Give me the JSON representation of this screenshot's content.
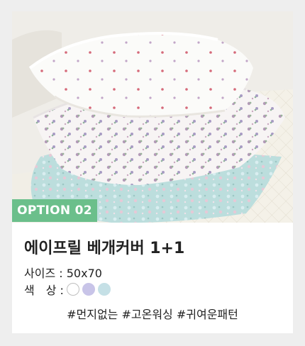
{
  "badge": {
    "label": "OPTION 02"
  },
  "product": {
    "title": "에이프릴 베개커버 1+1",
    "size_label": "사이즈 :",
    "size_value": "50x70",
    "color_label": "색　상 :",
    "colors": [
      {
        "name": "white",
        "hex": "#ffffff",
        "border": "#bfbfbf"
      },
      {
        "name": "lavender",
        "hex": "#c8c4e8",
        "border": "#c8c4e8"
      },
      {
        "name": "light-blue",
        "hex": "#c5e0e6",
        "border": "#c5e0e6"
      }
    ],
    "hashtags": "#먼지없는 #고온워싱 #귀여운패턴"
  },
  "colors": {
    "badge_bg": "#6bbf8b",
    "page_bg": "#eeeeee"
  }
}
